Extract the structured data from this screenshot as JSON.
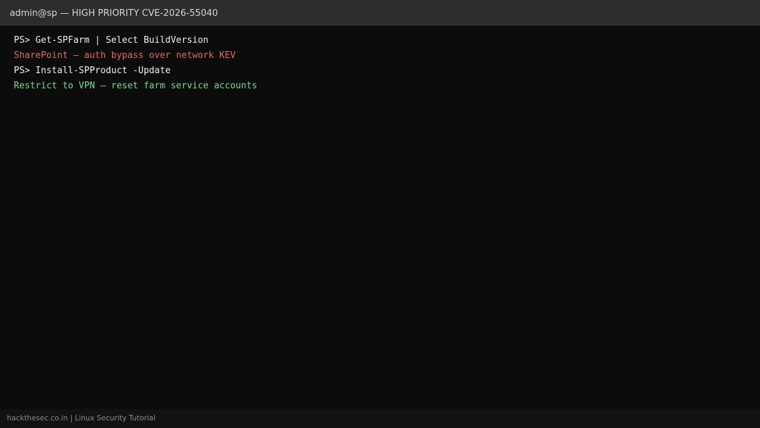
{
  "window": {
    "title": "admin@sp — HIGH PRIORITY CVE-2026-55040"
  },
  "terminal": {
    "lines": [
      {
        "kind": "command",
        "text": "PS> Get-SPFarm | Select BuildVersion"
      },
      {
        "kind": "alert",
        "text": "SharePoint — auth bypass over network KEV"
      },
      {
        "kind": "command",
        "text": "PS> Install-SPProduct -Update"
      },
      {
        "kind": "ok",
        "text": "Restrict to VPN — reset farm service accounts"
      }
    ]
  },
  "footer": {
    "credit": "hackthesec.co.in | Linux Security Tutorial"
  },
  "colors": {
    "background": "#0c0c0c",
    "titlebar": "#2d2d2d",
    "command_text": "#f0f0f0",
    "alert_text": "#e06c6c",
    "ok_text": "#7fd88f"
  }
}
